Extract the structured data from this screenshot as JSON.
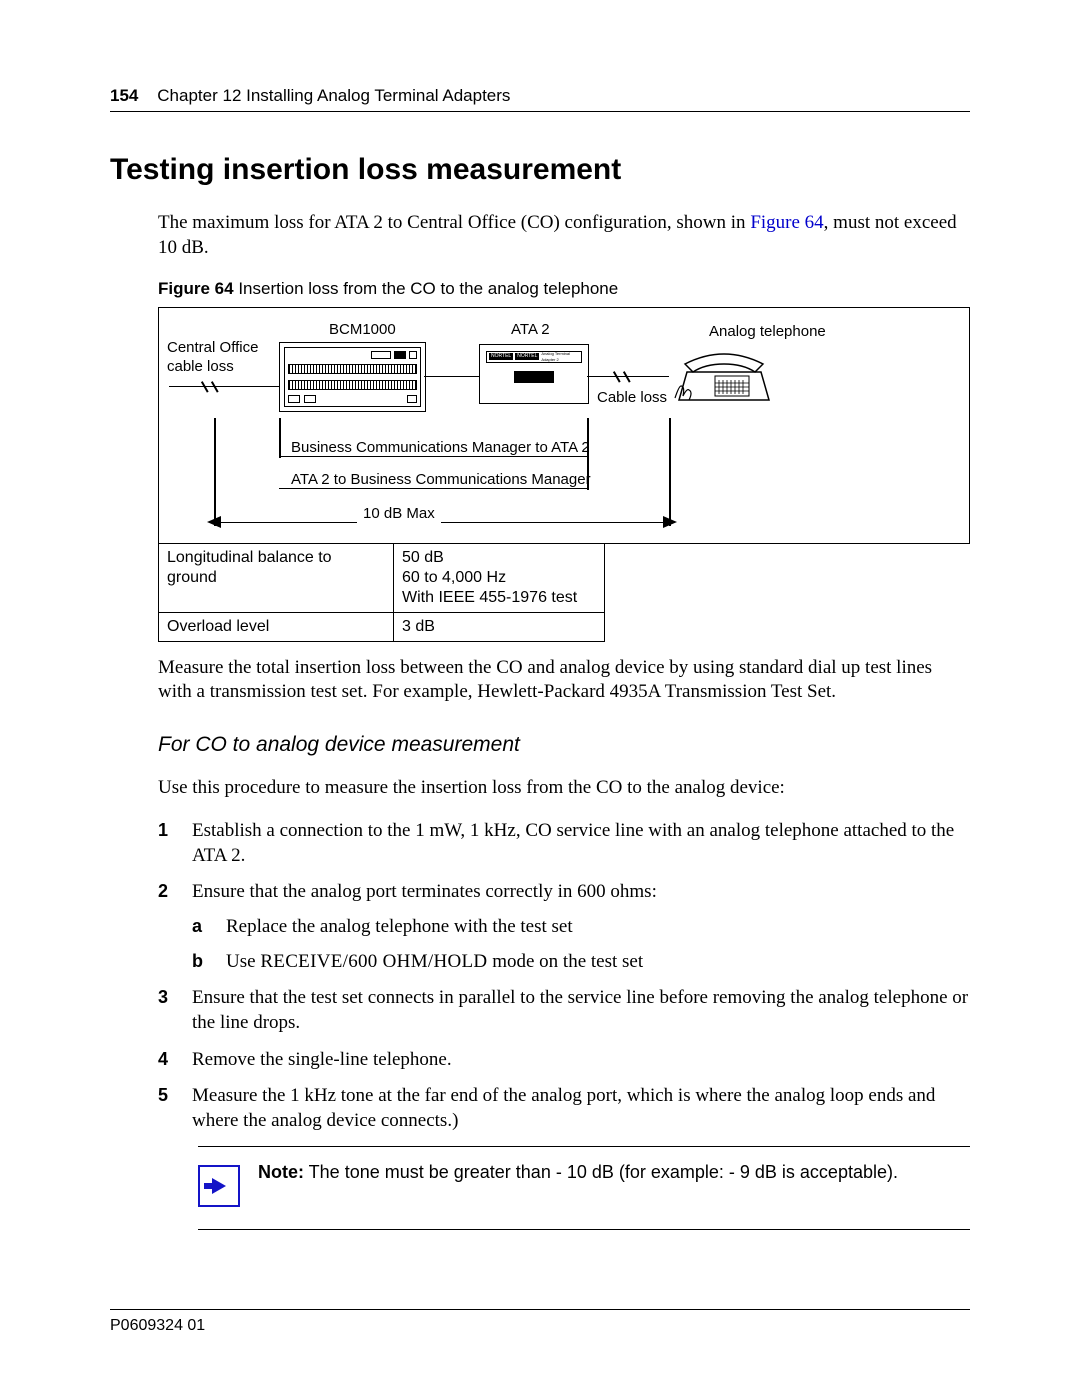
{
  "header": {
    "page_num": "154",
    "chapter": "Chapter 12  Installing Analog Terminal Adapters"
  },
  "h1": "Testing insertion loss measurement",
  "intro_1a": "The maximum loss for ATA 2 to Central Office (CO) configuration, shown in ",
  "intro_link": "Figure 64",
  "intro_1b": ", must not exceed 10 dB.",
  "fig_num": "Figure 64",
  "fig_caption": "   Insertion loss from the CO to the analog telephone",
  "diagram": {
    "bcm": "BCM1000",
    "ata": "ATA 2",
    "phone": "Analog telephone",
    "co_loss_1": "Central Office",
    "co_loss_2": "cable loss",
    "cable_loss": "Cable loss",
    "bcm_to_ata": "Business Communications Manager to ATA 2",
    "ata_to_bcm": "ATA 2 to Business Communications Manager",
    "max": "10 dB Max"
  },
  "spec": {
    "r1c1": "Longitudinal balance to ground",
    "r1c2a": "50 dB",
    "r1c2b": "60 to 4,000 Hz",
    "r1c2c": "With IEEE 455-1976 test",
    "r2c1": "Overload level",
    "r2c2": "3 dB"
  },
  "para2": "Measure the total insertion loss between the CO and analog device by using standard dial up test lines with a transmission test set. For example, Hewlett-Packard 4935A Transmission Test Set.",
  "h2": "For CO to analog device measurement",
  "para3": "Use this procedure to measure the insertion loss from the CO to the analog device:",
  "steps": {
    "s1": "Establish a connection to the 1 mW, 1 kHz, CO service line with an analog telephone attached to the ATA 2.",
    "s2": "Ensure that the analog port terminates correctly in 600 ohms:",
    "s2a": "Replace the analog telephone with the test set",
    "s2b_pre": "Use ",
    "s2b_sc": "RECEIVE/600 OHM/HOLD",
    "s2b_post": " mode on the test set",
    "s3": "Ensure that the test set connects in parallel to the service line before removing the analog telephone or the line drops.",
    "s4": "Remove the single-line telephone.",
    "s5": "Measure the 1 kHz tone at the far end of the analog port, which is where the analog loop ends and where the analog device connects.)"
  },
  "note": {
    "label": "Note:",
    "text": " The tone must be greater than - 10 dB (for example: - 9 dB is acceptable)."
  },
  "footer": "P0609324  01"
}
